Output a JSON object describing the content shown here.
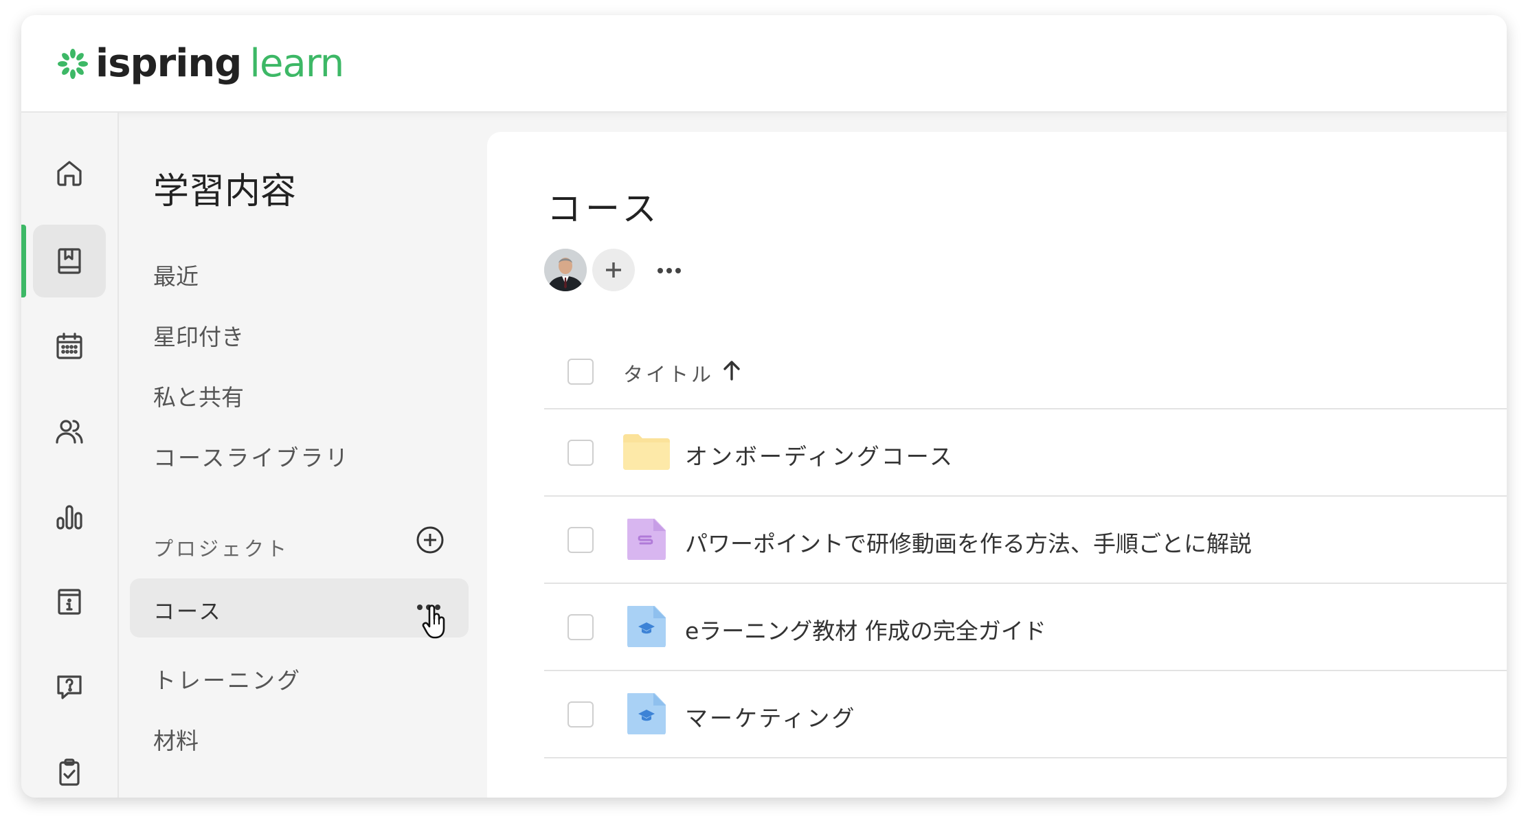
{
  "brand": {
    "part1": "ispring",
    "part2": "learn",
    "accent": "#3db866"
  },
  "rail": {
    "items": [
      {
        "icon": "home-icon"
      },
      {
        "icon": "book-icon",
        "active": true
      },
      {
        "icon": "calendar-icon"
      },
      {
        "icon": "users-icon"
      },
      {
        "icon": "bar-chart-icon"
      },
      {
        "icon": "info-icon"
      },
      {
        "icon": "help-chat-icon"
      },
      {
        "icon": "clipboard-check-icon"
      }
    ]
  },
  "nav": {
    "title": "学習内容",
    "items": [
      "最近",
      "星印付き",
      "私と共有",
      "コースライブラリ"
    ],
    "projects_label": "プロジェクト",
    "projects": [
      "コース",
      "トレーニング",
      "材料"
    ]
  },
  "main": {
    "title": "コース",
    "table": {
      "header_title": "タイトル",
      "rows": [
        {
          "title": "オンボーディングコース",
          "icon": "folder-icon",
          "color": "#fbe29a"
        },
        {
          "title": "パワーポイントで研修動画を作る方法、手順ごとに解説",
          "icon": "video-course-icon",
          "color": "#d8b6f0"
        },
        {
          "title": "eラーニング教材 作成の完全ガイド",
          "icon": "course-file-icon",
          "color": "#a9d1f5"
        },
        {
          "title": "マーケティング",
          "icon": "course-file-icon",
          "color": "#a9d1f5"
        }
      ]
    }
  }
}
